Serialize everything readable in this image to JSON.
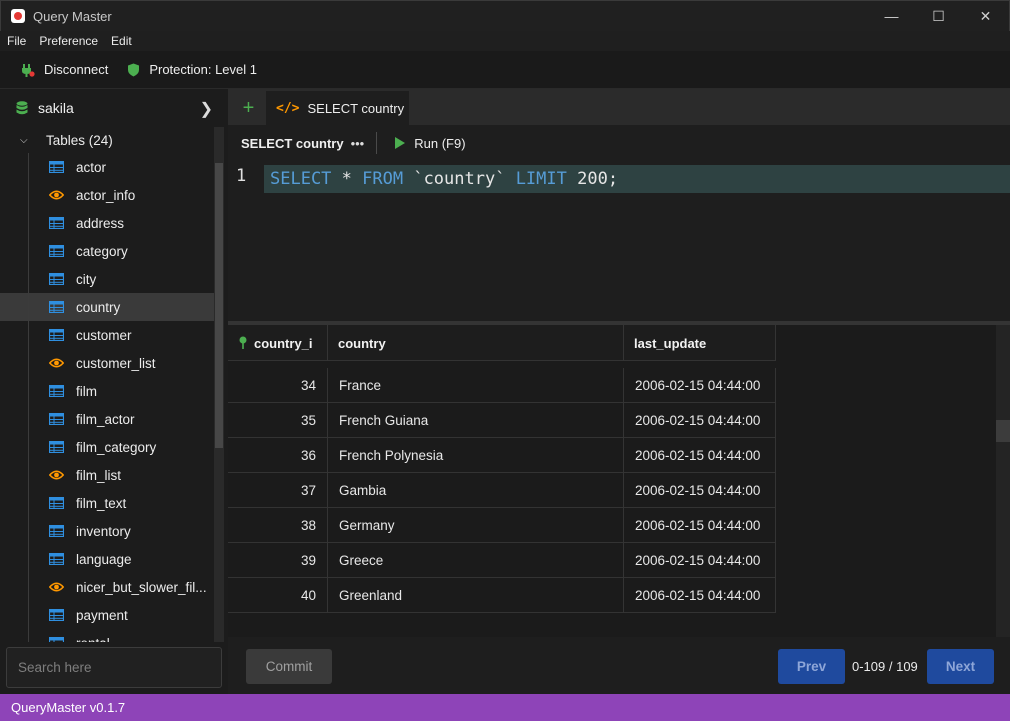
{
  "window": {
    "title": "Query Master",
    "minimize": "—",
    "maximize": "☐",
    "close": "✕"
  },
  "menu": [
    "File",
    "Preference",
    "Edit"
  ],
  "toolbar": {
    "disconnect": "Disconnect",
    "protection": "Protection: Level 1"
  },
  "sidebar": {
    "database": "sakila",
    "tables_header": "Tables (24)",
    "items": [
      {
        "label": "actor",
        "type": "table"
      },
      {
        "label": "actor_info",
        "type": "view"
      },
      {
        "label": "address",
        "type": "table"
      },
      {
        "label": "category",
        "type": "table"
      },
      {
        "label": "city",
        "type": "table"
      },
      {
        "label": "country",
        "type": "table",
        "selected": true
      },
      {
        "label": "customer",
        "type": "table"
      },
      {
        "label": "customer_list",
        "type": "view"
      },
      {
        "label": "film",
        "type": "table"
      },
      {
        "label": "film_actor",
        "type": "table"
      },
      {
        "label": "film_category",
        "type": "table"
      },
      {
        "label": "film_list",
        "type": "view"
      },
      {
        "label": "film_text",
        "type": "table"
      },
      {
        "label": "inventory",
        "type": "table"
      },
      {
        "label": "language",
        "type": "table"
      },
      {
        "label": "nicer_but_slower_fil...",
        "type": "view"
      },
      {
        "label": "payment",
        "type": "table"
      },
      {
        "label": "rental",
        "type": "table"
      }
    ],
    "search_placeholder": "Search here"
  },
  "tabs": {
    "add": "+",
    "active": {
      "icon": "</>",
      "label": "SELECT country"
    }
  },
  "query": {
    "name": "SELECT country",
    "more": "•••",
    "run": "Run (F9)"
  },
  "editor": {
    "line_number": "1",
    "tokens": [
      {
        "t": "SELECT",
        "kw": true
      },
      {
        "t": " * ",
        "kw": false
      },
      {
        "t": "FROM",
        "kw": true
      },
      {
        "t": " `country` ",
        "kw": false
      },
      {
        "t": "LIMIT",
        "kw": true
      },
      {
        "t": " 200;",
        "kw": false
      }
    ]
  },
  "grid": {
    "columns": [
      "country_i",
      "country",
      "last_update"
    ],
    "rows": [
      [
        "34",
        "France",
        "2006-02-15 04:44:00"
      ],
      [
        "35",
        "French Guiana",
        "2006-02-15 04:44:00"
      ],
      [
        "36",
        "French Polynesia",
        "2006-02-15 04:44:00"
      ],
      [
        "37",
        "Gambia",
        "2006-02-15 04:44:00"
      ],
      [
        "38",
        "Germany",
        "2006-02-15 04:44:00"
      ],
      [
        "39",
        "Greece",
        "2006-02-15 04:44:00"
      ],
      [
        "40",
        "Greenland",
        "2006-02-15 04:44:00"
      ]
    ]
  },
  "pager": {
    "commit": "Commit",
    "prev": "Prev",
    "info": "0-109 / 109",
    "next": "Next"
  },
  "status": {
    "version": "QueryMaster v0.1.7"
  },
  "colors": {
    "accent_green": "#4caf50",
    "view_orange": "#ff9800",
    "table_blue": "#2f8fe0",
    "status_purple": "#8e44b8",
    "button_blue": "#1f4a9e",
    "keyword_blue": "#569cd6"
  }
}
